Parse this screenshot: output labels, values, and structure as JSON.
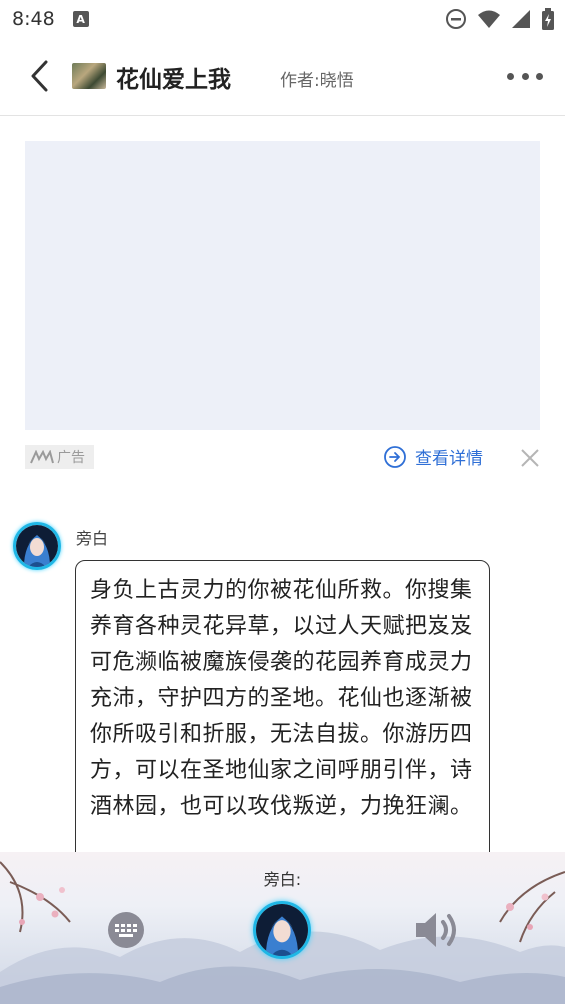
{
  "status_bar": {
    "time": "8:48",
    "notification_icon_letter": "A",
    "icons": [
      "do-not-disturb-icon",
      "wifi-icon",
      "signal-icon",
      "battery-icon"
    ]
  },
  "header": {
    "title": "花仙爱上我",
    "author": "作者:晓悟",
    "icons": [
      "back-arrow-icon",
      "book-cover-thumbnail",
      "more-icon"
    ]
  },
  "ad": {
    "tag_label": "广告",
    "detail_label": "查看详情",
    "accent_color": "#2f6fd6",
    "placeholder_color": "#edf0f8"
  },
  "chat": {
    "speaker": "旁白",
    "message": "身负上古灵力的你被花仙所救。你搜集养育各种灵花异草，以过人天赋把岌岌可危濒临被魔族侵袭的花园养育成灵力充沛，守护四方的圣地。花仙也逐渐被你所吸引和折服，无法自拔。你游历四方，可以在圣地仙家之间呼朋引伴，诗酒林园，也可以攻伐叛逆，力挽狂澜。",
    "avatar_ring_color": "#1fb7e6"
  },
  "bottom_panel": {
    "speaker_label": "旁白:",
    "icons": [
      "keyboard-icon",
      "narrator-avatar",
      "speaker-icon"
    ]
  }
}
